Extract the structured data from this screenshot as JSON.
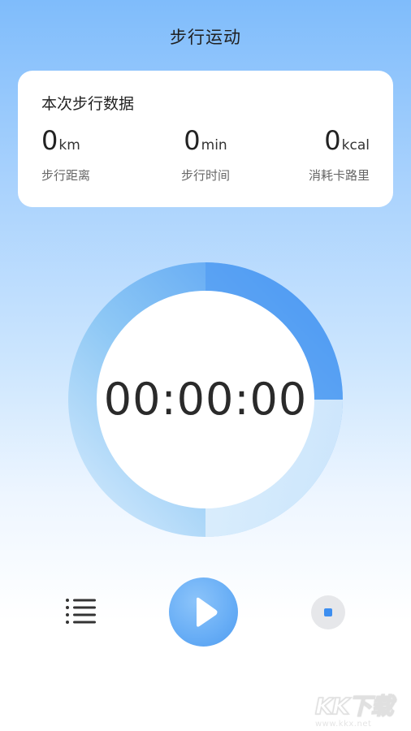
{
  "header": {
    "title": "步行运动"
  },
  "summary": {
    "title": "本次步行数据",
    "stats": [
      {
        "value": "0",
        "unit": "km",
        "label": "步行距离"
      },
      {
        "value": "0",
        "unit": "min",
        "label": "步行时间"
      },
      {
        "value": "0",
        "unit": "kcal",
        "label": "消耗卡路里"
      }
    ]
  },
  "timer": {
    "elapsed": "00:00:00",
    "ring_colors": {
      "start": "#4b98f3",
      "mid": "#8ec8f5",
      "end": "#dceefd"
    }
  },
  "controls": {
    "list_icon": "list-icon",
    "play_icon": "play-icon",
    "stop_icon": "stop-icon"
  },
  "watermark": {
    "logo": "KK下载",
    "url": "www.kkx.net"
  }
}
